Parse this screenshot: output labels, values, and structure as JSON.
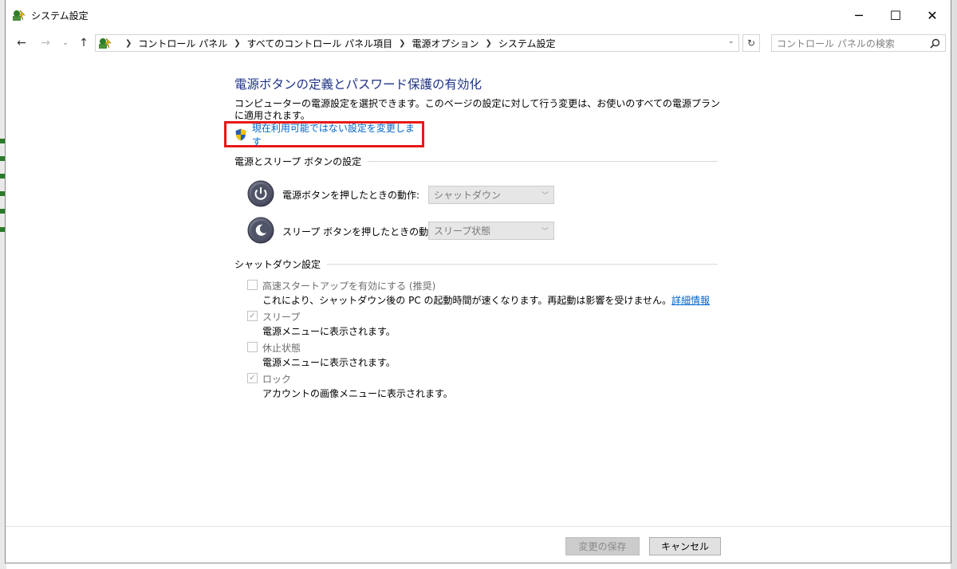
{
  "window": {
    "title": "システム設定",
    "minimize_glyph": "─",
    "maximize_glyph": "☐",
    "close_glyph": "✕"
  },
  "nav": {
    "back_glyph": "←",
    "forward_glyph": "→",
    "recent_glyph": "⌄",
    "up_glyph": "↑",
    "breadcrumbs": [
      "コントロール パネル",
      "すべてのコントロール パネル項目",
      "電源オプション",
      "システム設定"
    ],
    "refresh_glyph": "↻",
    "dropdown_glyph": "⌄"
  },
  "search": {
    "placeholder": "コントロール パネルの検索",
    "icon": "search-icon"
  },
  "page": {
    "title": "電源ボタンの定義とパスワード保護の有効化",
    "description": "コンピューターの電源設定を選択できます。このページの設定に対して行う変更は、お使いのすべての電源プランに適用されます。",
    "change_link": "現在利用可能ではない設定を変更します"
  },
  "power_section": {
    "heading": "電源とスリープ ボタンの設定",
    "power_button_label": "電源ボタンを押したときの動作:",
    "power_button_value": "シャットダウン",
    "sleep_button_label": "スリープ ボタンを押したときの動作:",
    "sleep_button_value": "スリープ状態"
  },
  "shutdown_section": {
    "heading": "シャットダウン設定",
    "options": [
      {
        "label": "高速スタートアップを有効にする (推奨)",
        "description": "これにより、シャットダウン後の PC の起動時間が速くなります。再起動は影響を受けません。",
        "link": "詳細情報",
        "checked": false
      },
      {
        "label": "スリープ",
        "description": "電源メニューに表示されます。",
        "checked": true
      },
      {
        "label": "休止状態",
        "description": "電源メニューに表示されます。",
        "checked": false
      },
      {
        "label": "ロック",
        "description": "アカウントの画像メニューに表示されます。",
        "checked": true
      }
    ]
  },
  "footer": {
    "save_label": "変更の保存",
    "cancel_label": "キャンセル"
  },
  "colors": {
    "title_blue": "#1e3287",
    "link_blue": "#0066cc",
    "highlight_red": "#e81818"
  }
}
